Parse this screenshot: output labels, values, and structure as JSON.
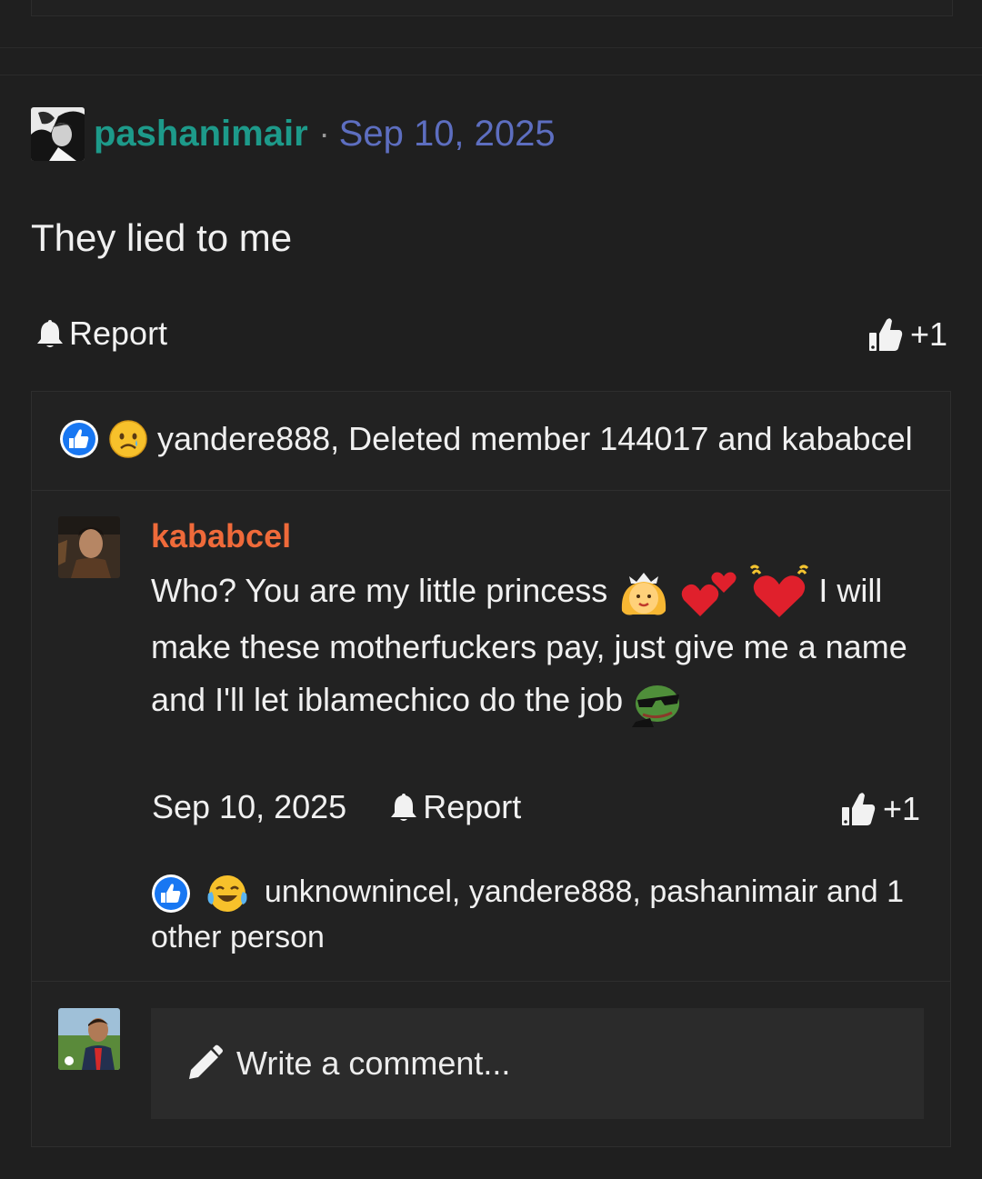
{
  "post": {
    "username": "pashanimair",
    "separator": "·",
    "date": "Sep 10, 2025",
    "body": "They lied to me",
    "report_label": "Report",
    "like_count": "+1"
  },
  "post_reactions": {
    "text": "yandere888, Deleted member 144017 and kababcel",
    "icons": [
      "like-badge-icon",
      "sad-face-icon"
    ]
  },
  "comment": {
    "username": "kababcel",
    "text_part1": "Who? You are my little princess",
    "text_part2": "I will make these motherfuckers pay, just give me a name and I'll let iblamechico do the job",
    "emojis": [
      "princess-emoji",
      "two-hearts-emoji",
      "beating-heart-emoji",
      "pepe-sunglasses-emoji"
    ],
    "date": "Sep 10, 2025",
    "report_label": "Report",
    "like_count": "+1",
    "reactions_text": "unknownincel, yandere888, pashanimair and 1 other person",
    "reaction_icons": [
      "like-badge-icon",
      "laughing-crying-icon"
    ]
  },
  "reply": {
    "placeholder": "Write a comment..."
  },
  "colors": {
    "background": "#1f1f1f",
    "post_username": "#1d9a8a",
    "post_date": "#5d6ec0",
    "comment_username": "#ef6a3a",
    "like_badge": "#1877f2"
  }
}
